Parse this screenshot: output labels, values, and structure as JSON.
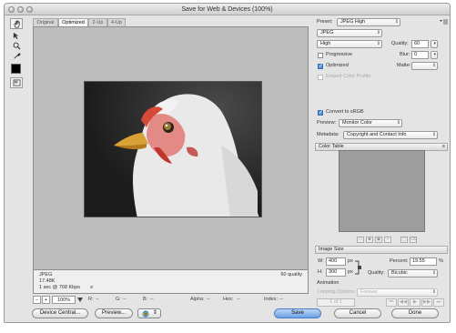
{
  "window": {
    "title": "Save for Web & Devices (100%)"
  },
  "tools": {
    "hand": "hand-icon",
    "slice_select": "slice-select-icon",
    "zoom": "zoom-icon",
    "eyedropper": "eyedropper-icon",
    "eyedropper_color": "#000000",
    "toggle_slices": "toggle-slices-icon"
  },
  "tabs": [
    {
      "label": "Original"
    },
    {
      "label": "Optimized",
      "active": true
    },
    {
      "label": "2-Up"
    },
    {
      "label": "4-Up"
    }
  ],
  "image_info": {
    "format": "JPEG",
    "size": "17.48K",
    "time": "1 sec @ 768 Kbps",
    "menu_icon": "≡",
    "quality": "60 quality"
  },
  "status": {
    "zoom": "100%",
    "r_label": "R:",
    "r_value": "--",
    "g_label": "G:",
    "g_value": "--",
    "b_label": "B:",
    "b_value": "--",
    "alpha_label": "Alpha:",
    "alpha_value": "--",
    "hex_label": "Hex:",
    "hex_value": "--",
    "index_label": "Index:",
    "index_value": "--"
  },
  "buttons": {
    "device_central": "Device Central...",
    "preview": "Preview...",
    "save": "Save",
    "cancel": "Cancel",
    "done": "Done"
  },
  "settings": {
    "preset_label": "Preset:",
    "preset_value": "JPEG High",
    "format_value": "JPEG",
    "quality_level": "High",
    "quality_label": "Quality:",
    "quality_value": "60",
    "progressive_label": "Progressive",
    "progressive_checked": false,
    "blur_label": "Blur:",
    "blur_value": "0",
    "optimized_label": "Optimized",
    "optimized_checked": true,
    "matte_label": "Matte:",
    "embed_profile_label": "Embed Color Profile",
    "convert_srgb_label": "Convert to sRGB",
    "convert_srgb_checked": true,
    "preview_label": "Preview:",
    "preview_value": "Monitor Color",
    "metadata_label": "Metadata:",
    "metadata_value": "Copyright and Contact Info"
  },
  "color_table": {
    "title": "Color Table"
  },
  "image_size": {
    "title": "Image Size",
    "w_label": "W:",
    "w_value": "400",
    "h_label": "H:",
    "h_value": "300",
    "unit": "px",
    "percent_label": "Percent:",
    "percent_value": "19.55",
    "percent_unit": "%",
    "quality_label": "Quality:",
    "quality_value": "Bicubic"
  },
  "animation": {
    "title": "Animation",
    "looping_label": "Looping Options:",
    "looping_value": "Forever",
    "frame_counter": "1 of 1"
  }
}
